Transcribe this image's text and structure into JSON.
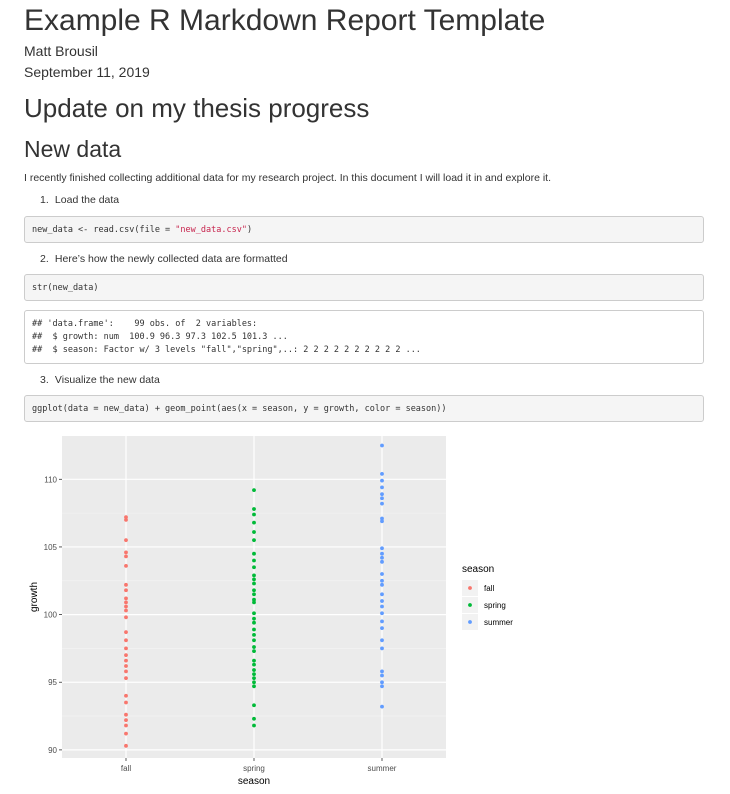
{
  "document": {
    "title": "Example R Markdown Report Template",
    "author": "Matt Brousil",
    "date": "September 11, 2019",
    "h1": "Update on my thesis progress",
    "h2": "New data",
    "intro": "I recently finished collecting additional data for my research project. In this document I will load it in and explore it.",
    "steps": [
      {
        "num": "1.",
        "label": "Load the data"
      },
      {
        "num": "2.",
        "label": "Here’s how the newly collected data are formatted"
      },
      {
        "num": "3.",
        "label": "Visualize the new data"
      }
    ],
    "code_load": {
      "prefix": "new_data <- read.csv(file = ",
      "string": "\"new_data.csv\"",
      "suffix": ")"
    },
    "code_str": "str(new_data)",
    "output_str": [
      "## 'data.frame':    99 obs. of  2 variables:",
      "##  $ growth: num  100.9 96.3 97.3 102.5 101.3 ...",
      "##  $ season: Factor w/ 3 levels \"fall\",\"spring\",..: 2 2 2 2 2 2 2 2 2 2 ..."
    ],
    "code_plot": "ggplot(data = new_data) + geom_point(aes(x = season, y = growth, color = season))"
  },
  "colors": {
    "fall": "#F8766D",
    "spring": "#00BA38",
    "summer": "#619CFF",
    "panel": "#EBEBEB"
  },
  "chart_data": {
    "type": "scatter",
    "title": "",
    "xlabel": "season",
    "ylabel": "growth",
    "categories": [
      "fall",
      "spring",
      "summer"
    ],
    "ylim": [
      89.4,
      113.2
    ],
    "yticks": [
      90,
      95,
      100,
      105,
      110
    ],
    "grid": true,
    "legend": {
      "title": "season",
      "placement": "right"
    },
    "series": [
      {
        "name": "fall",
        "color": "#F8766D",
        "values": [
          107.2,
          107.0,
          105.5,
          104.6,
          104.3,
          103.6,
          102.2,
          101.8,
          101.2,
          100.9,
          100.6,
          100.3,
          99.8,
          98.7,
          98.1,
          97.5,
          97.0,
          96.6,
          96.2,
          95.8,
          95.3,
          94.0,
          93.5,
          92.6,
          92.2,
          91.8,
          91.2,
          90.3
        ]
      },
      {
        "name": "spring",
        "color": "#00BA38",
        "values": [
          109.2,
          107.8,
          107.4,
          106.8,
          106.1,
          105.5,
          104.5,
          104.0,
          103.5,
          102.9,
          102.6,
          102.3,
          101.8,
          101.5,
          101.1,
          100.9,
          100.1,
          99.7,
          99.4,
          98.9,
          98.5,
          98.1,
          97.6,
          97.3,
          96.6,
          96.3,
          95.9,
          95.6,
          95.3,
          95.0,
          94.7,
          93.3,
          92.3,
          91.8
        ]
      },
      {
        "name": "summer",
        "color": "#619CFF",
        "values": [
          112.5,
          110.4,
          109.9,
          109.4,
          108.9,
          108.6,
          108.2,
          107.1,
          106.9,
          104.9,
          104.5,
          104.2,
          103.9,
          103.0,
          102.5,
          102.2,
          101.5,
          101.0,
          100.6,
          100.1,
          99.5,
          99.0,
          98.1,
          97.5,
          95.8,
          95.5,
          95.0,
          94.7,
          93.2
        ]
      }
    ]
  }
}
